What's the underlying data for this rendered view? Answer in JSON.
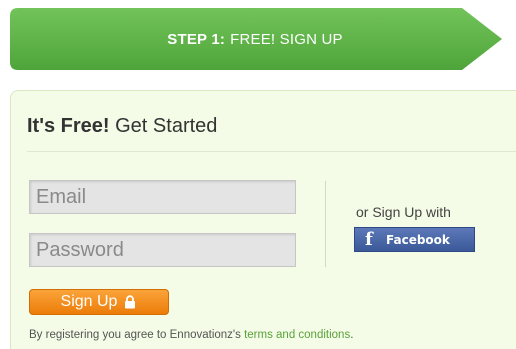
{
  "step": {
    "label_strong": "STEP 1:",
    "label_rest": "FREE! SIGN UP"
  },
  "panel": {
    "title_bold": "It's Free!",
    "title_rest": "Get Started",
    "email_placeholder": "Email",
    "password_placeholder": "Password",
    "or_signup_text": "or Sign Up with",
    "facebook_label": "Facebook",
    "signup_label": "Sign Up",
    "legal_prefix": "By registering you agree to Ennovationz's",
    "legal_link": "terms and conditions",
    "legal_suffix": "."
  },
  "icons": {
    "facebook": "facebook-f-icon",
    "lock": "lock-icon"
  },
  "colors": {
    "banner_green": "#5fb64a",
    "panel_bg": "#f4fbe6",
    "facebook_blue": "#3b5998",
    "signup_orange": "#f18d1c",
    "link_green": "#5aa33b"
  }
}
